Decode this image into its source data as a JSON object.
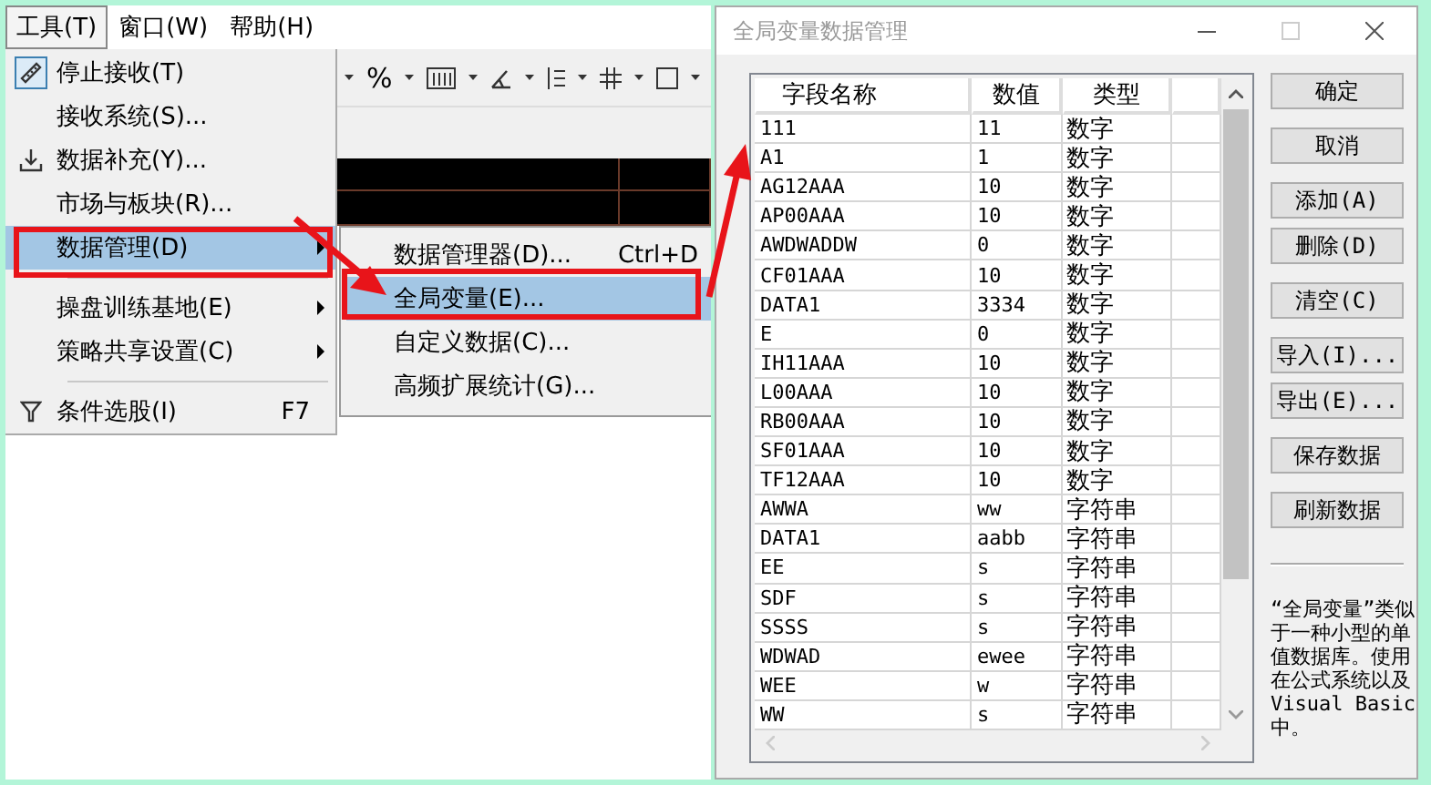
{
  "menu_bar": [
    {
      "label": "工具(T)",
      "selected": true
    },
    {
      "label": "窗口(W)",
      "selected": false
    },
    {
      "label": "帮助(H)",
      "selected": false
    }
  ],
  "toolbar": {
    "symbol": "%"
  },
  "tools_menu": [
    {
      "kind": "tool",
      "label": "停止接收(T)",
      "checked": true,
      "submenu": false,
      "selected": false
    },
    {
      "kind": "plain",
      "label": "接收系统(S)...",
      "checked": false,
      "submenu": false,
      "selected": false
    },
    {
      "kind": "download",
      "label": "数据补充(Y)...",
      "checked": false,
      "submenu": false,
      "selected": false
    },
    {
      "kind": "plain",
      "label": "市场与板块(R)...",
      "checked": false,
      "submenu": false,
      "selected": false
    },
    {
      "kind": "plain",
      "label": "数据管理(D)",
      "checked": false,
      "submenu": true,
      "selected": true
    },
    {
      "kind": "separator"
    },
    {
      "kind": "plain",
      "label": "操盘训练基地(E)",
      "checked": false,
      "submenu": true,
      "selected": false
    },
    {
      "kind": "plain",
      "label": "策略共享设置(C)",
      "checked": false,
      "submenu": true,
      "selected": false
    },
    {
      "kind": "separator"
    },
    {
      "kind": "filter",
      "label": "条件选股(I)",
      "shortcut": "F7",
      "checked": false,
      "submenu": false,
      "selected": false
    }
  ],
  "data_submenu": [
    {
      "label": "数据管理器(D)...",
      "shortcut": "Ctrl+D",
      "selected": false
    },
    {
      "label": "全局变量(E)...",
      "selected": true
    },
    {
      "label": "自定义数据(C)...",
      "selected": false
    },
    {
      "label": "高频扩展统计(G)...",
      "selected": false
    }
  ],
  "dialog": {
    "title": "全局变量数据管理",
    "columns": [
      "字段名称",
      "数值",
      "类型"
    ],
    "rows": [
      {
        "name": "111",
        "value": "11",
        "type": "数字"
      },
      {
        "name": "A1",
        "value": "1",
        "type": "数字"
      },
      {
        "name": "AG12AAA",
        "value": "10",
        "type": "数字"
      },
      {
        "name": "AP00AAA",
        "value": "10",
        "type": "数字"
      },
      {
        "name": "AWDWADDW",
        "value": "0",
        "type": "数字"
      },
      {
        "name": "CF01AAA",
        "value": "10",
        "type": "数字"
      },
      {
        "name": "DATA1",
        "value": "3334",
        "type": "数字"
      },
      {
        "name": "E",
        "value": "0",
        "type": "数字"
      },
      {
        "name": "IH11AAA",
        "value": "10",
        "type": "数字"
      },
      {
        "name": "L00AAA",
        "value": "10",
        "type": "数字"
      },
      {
        "name": "RB00AAA",
        "value": "10",
        "type": "数字"
      },
      {
        "name": "SF01AAA",
        "value": "10",
        "type": "数字"
      },
      {
        "name": "TF12AAA",
        "value": "10",
        "type": "数字"
      },
      {
        "name": "AWWA",
        "value": "ww",
        "type": "字符串"
      },
      {
        "name": "DATA1",
        "value": "aabb",
        "type": "字符串"
      },
      {
        "name": "EE",
        "value": "s",
        "type": "字符串"
      },
      {
        "name": "SDF",
        "value": "s",
        "type": "字符串"
      },
      {
        "name": "SSSS",
        "value": "s",
        "type": "字符串"
      },
      {
        "name": "WDWAD",
        "value": "ewee",
        "type": "字符串"
      },
      {
        "name": "WEE",
        "value": "w",
        "type": "字符串"
      },
      {
        "name": "WW",
        "value": "s",
        "type": "字符串"
      }
    ],
    "button_groups": [
      [
        "确定"
      ],
      [
        "取消"
      ],
      [
        "添加(A)",
        "删除(D)"
      ],
      [
        "清空(C)"
      ],
      [
        "导入(I)...",
        "导出(E)..."
      ],
      [
        "保存数据"
      ],
      [
        "刷新数据"
      ]
    ],
    "note": "“全局变量”类似于一种小型的单值数据库。使用在公式系统以及Visual Basic中。"
  }
}
